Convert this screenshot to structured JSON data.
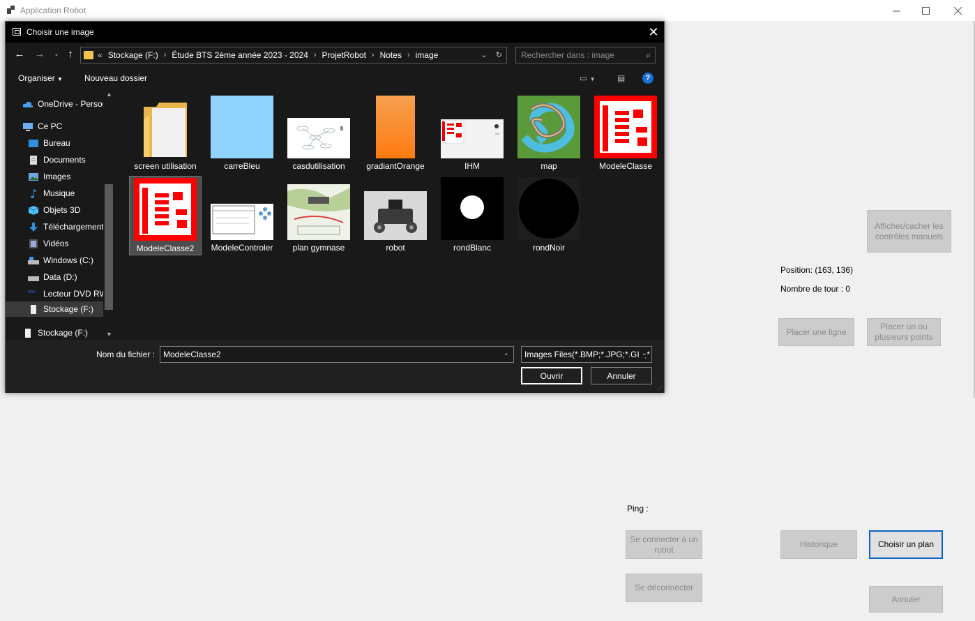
{
  "app": {
    "title": "Application Robot",
    "buttons": {
      "toggle_manual": "Afficher/cacher les contrôles manuels",
      "place_line": "Placer une ligne",
      "place_points": "Placer un ou plusieurs points",
      "connect": "Se connecter à un robot",
      "disconnect": "Se déconnecter",
      "history": "Historique",
      "choose_plan": "Choisir un plan",
      "cancel": "Annuler"
    },
    "labels": {
      "position": "Position: (163, 136)",
      "tour_count": "Nombre de tour : 0",
      "ping": "Ping :"
    }
  },
  "dialog": {
    "title": "Choisir une image",
    "breadcrumb": [
      "«",
      "Stockage (F:)",
      "Étude BTS 2ème année 2023 - 2024",
      "ProjetRobot",
      "Notes",
      "image"
    ],
    "search_placeholder": "Rechercher dans : image",
    "commands": {
      "organize": "Organiser",
      "new_folder": "Nouveau dossier"
    },
    "nav_items": [
      {
        "label": "OneDrive - Person",
        "icon": "cloud-icon"
      },
      {
        "label": "Ce PC",
        "icon": "computer-icon"
      },
      {
        "label": "Bureau",
        "icon": "desktop-icon"
      },
      {
        "label": "Documents",
        "icon": "documents-icon"
      },
      {
        "label": "Images",
        "icon": "pictures-icon"
      },
      {
        "label": "Musique",
        "icon": "music-icon"
      },
      {
        "label": "Objets 3D",
        "icon": "cube-icon"
      },
      {
        "label": "Téléchargements",
        "icon": "download-icon"
      },
      {
        "label": "Vidéos",
        "icon": "video-icon"
      },
      {
        "label": "Windows (C:)",
        "icon": "drive-icon"
      },
      {
        "label": "Data (D:)",
        "icon": "drive-icon"
      },
      {
        "label": "Lecteur DVD RW",
        "icon": "dvd-icon"
      },
      {
        "label": "Stockage (F:)",
        "icon": "usb-drive-icon"
      },
      {
        "label": "Stockage (F:)",
        "icon": "usb-drive-icon"
      }
    ],
    "files": [
      {
        "name": "screen utilisation"
      },
      {
        "name": "carreBleu"
      },
      {
        "name": "casdutilisation"
      },
      {
        "name": "gradiantOrange"
      },
      {
        "name": "IHM"
      },
      {
        "name": "map"
      },
      {
        "name": "ModeleClasse"
      },
      {
        "name": "ModeleClasse2"
      },
      {
        "name": "ModeleControler"
      },
      {
        "name": "plan gymnase"
      },
      {
        "name": "robot"
      },
      {
        "name": "rondBlanc"
      },
      {
        "name": "rondNoir"
      }
    ],
    "filename_label": "Nom du fichier :",
    "filename_value": "ModeleClasse2",
    "filter_value": "Images Files(*.BMP;*.JPG;*.GIF;*",
    "open_button": "Ouvrir",
    "cancel_button": "Annuler"
  },
  "colors": {
    "accent_blue": "#0a64c8",
    "red": "#ff0000",
    "light_blue": "#8fd3fe",
    "orange": "#ff8a1e"
  }
}
